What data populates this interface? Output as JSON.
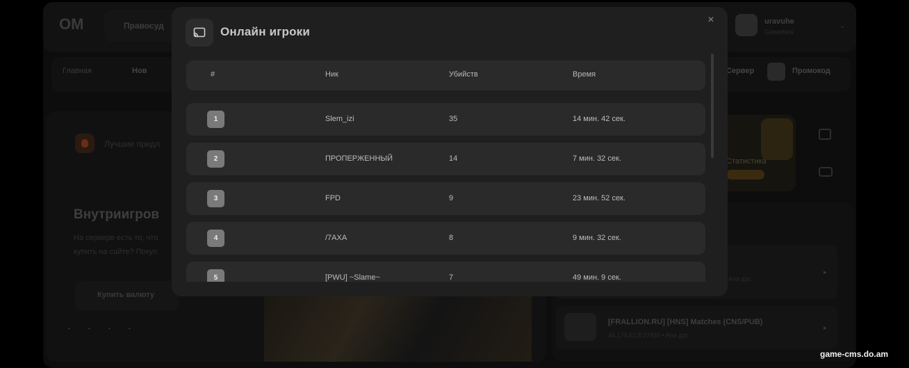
{
  "background": {
    "nav_item": "Правосуд",
    "user": {
      "name": "uravuhe",
      "subtitle": "Gewerbea"
    },
    "menu": [
      "Главная",
      "Нов",
      "Сервер",
      "Промокод"
    ],
    "best_label": "Лучшие предл",
    "heading": "Внутриигров",
    "desc_line1": "На сервере есть то, что",
    "desc_line2": "купить на сайте? Покуп",
    "buy_button": "Купить валюту",
    "dots": "• • • •",
    "stat_label": "Статистика",
    "server2_title": "[FRALLION.RU] [HNS] Matches (CNS/PUB)",
    "server2_sub": "46.174.52.8:27939 • Ana дэс",
    "server1_sub": "Ana дэс"
  },
  "modal": {
    "title": "Онлайн игроки",
    "icon": "cast-icon",
    "close_glyph": "×",
    "columns": {
      "rank": "#",
      "nick": "Ник",
      "kills": "Убийств",
      "time": "Время"
    },
    "players": [
      {
        "rank": "1",
        "nick": "Slem_izi",
        "kills": "35",
        "time": "14 мин. 42 сек."
      },
      {
        "rank": "2",
        "nick": "ПРОПЕРЖЕННЫЙ",
        "kills": "14",
        "time": "7 мин. 32 сек."
      },
      {
        "rank": "3",
        "nick": "FPD",
        "kills": "9",
        "time": "23 мин. 52 сек."
      },
      {
        "rank": "4",
        "nick": "/7AXA",
        "kills": "8",
        "time": "9 мин. 32 сек."
      },
      {
        "rank": "5",
        "nick": "[PWU] ~Slame~",
        "kills": "7",
        "time": "49 мин. 9 сек."
      }
    ]
  },
  "watermark": "game-cms.do.am"
}
